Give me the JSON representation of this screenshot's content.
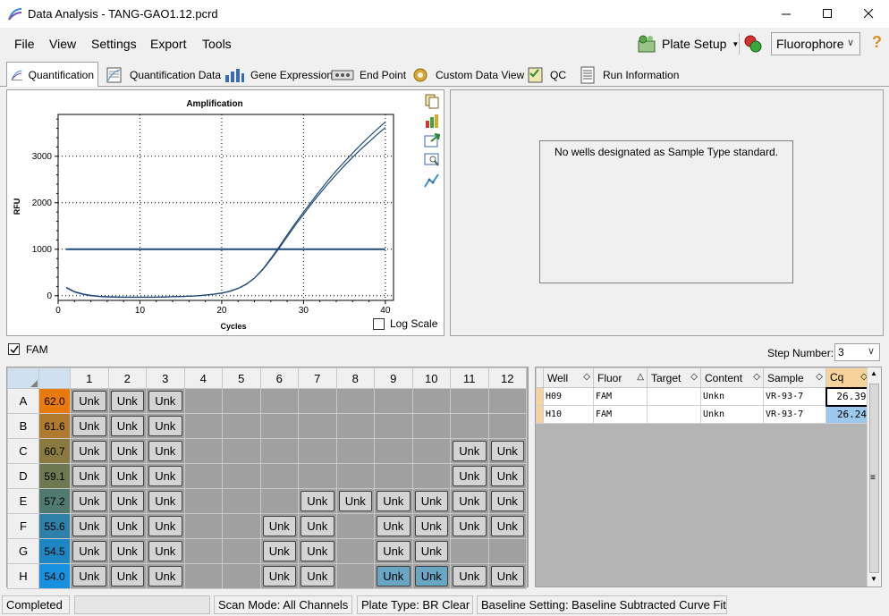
{
  "window": {
    "title": "Data Analysis - TANG-GAO1.12.pcrd"
  },
  "menu": [
    "File",
    "View",
    "Settings",
    "Export",
    "Tools"
  ],
  "toolbar": {
    "plate_setup": "Plate Setup",
    "fluorophore": "Fluorophore",
    "help": "?"
  },
  "tabs": [
    "Quantification",
    "Quantification Data",
    "Gene Expression",
    "End Point",
    "Custom Data View",
    "QC",
    "Run Information"
  ],
  "chart": {
    "title": "Amplification",
    "xlabel": "Cycles",
    "ylabel": "RFU",
    "log_scale_label": "Log Scale"
  },
  "chart_data": {
    "type": "line",
    "title": "Amplification",
    "xlabel": "Cycles",
    "ylabel": "RFU",
    "xlim": [
      0,
      41
    ],
    "ylim": [
      -100,
      3900
    ],
    "xticks": [
      0,
      10,
      20,
      30,
      40
    ],
    "yticks": [
      0,
      1000,
      2000,
      3000
    ],
    "grid": true,
    "threshold": 1000,
    "x": [
      1,
      2,
      3,
      4,
      5,
      6,
      7,
      8,
      9,
      10,
      11,
      12,
      13,
      14,
      15,
      16,
      17,
      18,
      19,
      20,
      21,
      22,
      23,
      24,
      25,
      26,
      27,
      28,
      29,
      30,
      31,
      32,
      33,
      34,
      35,
      36,
      37,
      38,
      39,
      40
    ],
    "series": [
      {
        "well": "H09",
        "values": [
          180,
          90,
          40,
          10,
          -10,
          -20,
          -25,
          -30,
          -30,
          -30,
          -30,
          -28,
          -25,
          -20,
          -15,
          -10,
          0,
          15,
          35,
          60,
          100,
          160,
          250,
          380,
          560,
          780,
          1020,
          1270,
          1520,
          1750,
          1980,
          2200,
          2410,
          2610,
          2800,
          2980,
          3150,
          3310,
          3470,
          3620
        ]
      },
      {
        "well": "H10",
        "values": [
          170,
          80,
          30,
          0,
          -15,
          -25,
          -30,
          -32,
          -32,
          -32,
          -32,
          -30,
          -28,
          -22,
          -18,
          -12,
          -2,
          12,
          30,
          55,
          95,
          155,
          245,
          380,
          570,
          800,
          1050,
          1310,
          1560,
          1800,
          2030,
          2260,
          2480,
          2690,
          2880,
          3070,
          3250,
          3420,
          3580,
          3740
        ]
      }
    ]
  },
  "standard": {
    "message": "No wells designated as Sample Type standard."
  },
  "fam": {
    "label": "FAM",
    "checked": true
  },
  "step": {
    "label": "Step Number:",
    "value": "3"
  },
  "plate": {
    "columns": [
      "1",
      "2",
      "3",
      "4",
      "5",
      "6",
      "7",
      "8",
      "9",
      "10",
      "11",
      "12"
    ],
    "rows": [
      {
        "label": "A",
        "temp": "62.0",
        "color": "#e87a0c",
        "cells": [
          1,
          1,
          1,
          0,
          0,
          0,
          0,
          0,
          0,
          0,
          0,
          0
        ]
      },
      {
        "label": "B",
        "temp": "61.6",
        "color": "#b07a2e",
        "cells": [
          1,
          1,
          1,
          0,
          0,
          0,
          0,
          0,
          0,
          0,
          0,
          0
        ]
      },
      {
        "label": "C",
        "temp": "60.7",
        "color": "#8a7a40",
        "cells": [
          1,
          1,
          1,
          0,
          0,
          0,
          0,
          0,
          0,
          0,
          1,
          1
        ]
      },
      {
        "label": "D",
        "temp": "59.1",
        "color": "#6e7850",
        "cells": [
          1,
          1,
          1,
          0,
          0,
          0,
          0,
          0,
          0,
          0,
          1,
          1
        ]
      },
      {
        "label": "E",
        "temp": "57.2",
        "color": "#507a70",
        "cells": [
          1,
          1,
          1,
          0,
          0,
          0,
          1,
          1,
          1,
          1,
          1,
          1
        ]
      },
      {
        "label": "F",
        "temp": "55.6",
        "color": "#2e80a8",
        "cells": [
          1,
          1,
          1,
          0,
          0,
          1,
          1,
          0,
          1,
          1,
          1,
          1
        ]
      },
      {
        "label": "G",
        "temp": "54.5",
        "color": "#1f86c4",
        "cells": [
          1,
          1,
          1,
          0,
          0,
          1,
          1,
          0,
          1,
          1,
          0,
          0
        ]
      },
      {
        "label": "H",
        "temp": "54.0",
        "color": "#1790e0",
        "cells": [
          1,
          1,
          1,
          0,
          0,
          1,
          1,
          0,
          2,
          2,
          1,
          1
        ]
      }
    ],
    "unk_label": "Unk"
  },
  "results": {
    "headers": [
      "Well",
      "Fluor",
      "Target",
      "Content",
      "Sample",
      "Cq"
    ],
    "rows": [
      {
        "well": "H09",
        "fluor": "FAM",
        "target": "",
        "content": "Unkn",
        "sample": "VR-93-7",
        "cq": "26.39"
      },
      {
        "well": "H10",
        "fluor": "FAM",
        "target": "",
        "content": "Unkn",
        "sample": "VR-93-7",
        "cq": "26.24"
      }
    ]
  },
  "status": {
    "state": "Completed",
    "scan_mode": "Scan Mode: All Channels",
    "plate_type": "Plate Type: BR Clear",
    "baseline": "Baseline Setting: Baseline Subtracted Curve Fit"
  }
}
